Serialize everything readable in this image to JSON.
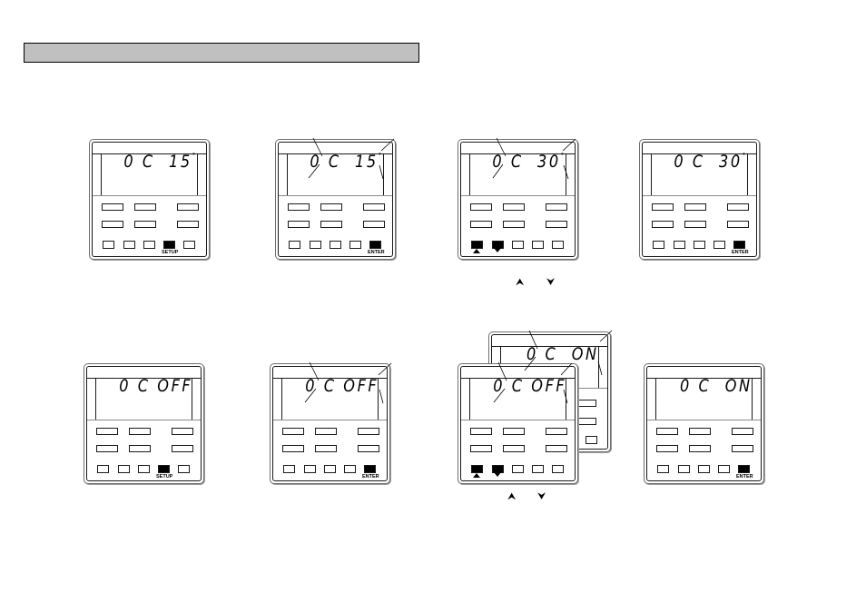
{
  "page": {
    "title_bar_text": ""
  },
  "panels": [
    {
      "id": "p1",
      "display": "0 C  15",
      "degree": "°",
      "bottom_buttons": [
        "",
        "",
        "",
        "SETUP",
        ""
      ],
      "filled": [
        3
      ],
      "label_under": {
        "3": "SETUP"
      },
      "callouts": false
    },
    {
      "id": "p2",
      "display": "0 C  15",
      "degree": "°",
      "bottom_buttons": [
        "",
        "",
        "",
        "",
        "ENTER"
      ],
      "filled": [
        4
      ],
      "label_under": {
        "4": "ENTER"
      },
      "callouts": true
    },
    {
      "id": "p3",
      "display": "0 C  30",
      "degree": "°",
      "bottom_buttons": [
        "▲",
        "▼",
        "",
        "",
        ""
      ],
      "filled": [
        0,
        1
      ],
      "label_under": {},
      "callouts": true
    },
    {
      "id": "p4",
      "display": "0 C  30",
      "degree": "°",
      "bottom_buttons": [
        "",
        "",
        "",
        "",
        "ENTER"
      ],
      "filled": [
        4
      ],
      "label_under": {
        "4": "ENTER"
      },
      "callouts": false
    },
    {
      "id": "p5",
      "display": "0 C OFF",
      "degree": "",
      "bottom_buttons": [
        "",
        "",
        "",
        "SETUP",
        ""
      ],
      "filled": [
        3
      ],
      "label_under": {
        "3": "SETUP"
      },
      "callouts": false
    },
    {
      "id": "p6",
      "display": "0 C OFF",
      "degree": "",
      "bottom_buttons": [
        "",
        "",
        "",
        "",
        "ENTER"
      ],
      "filled": [
        4
      ],
      "label_under": {
        "4": "ENTER"
      },
      "callouts": true
    },
    {
      "id": "p7-back",
      "display": "0 C  ON",
      "degree": "",
      "callouts": true
    },
    {
      "id": "p7",
      "display": "0 C OFF",
      "degree": "",
      "bottom_buttons": [
        "▲",
        "▼",
        "",
        "",
        ""
      ],
      "filled": [
        0,
        1
      ],
      "label_under": {},
      "callouts": true
    },
    {
      "id": "p8",
      "display": "0 C  ON",
      "degree": "",
      "bottom_buttons": [
        "",
        "",
        "",
        "",
        "ENTER"
      ],
      "filled": [
        4
      ],
      "label_under": {
        "4": "ENTER"
      },
      "callouts": false
    }
  ],
  "captions": {
    "up_down_row1": {
      "up_icon": "⮝",
      "down_icon": "⮟"
    },
    "up_down_row2": {
      "up_icon": "⮝",
      "down_icon": "⮟"
    }
  },
  "labels": {
    "setup": "SETUP",
    "enter": "ENTER"
  }
}
